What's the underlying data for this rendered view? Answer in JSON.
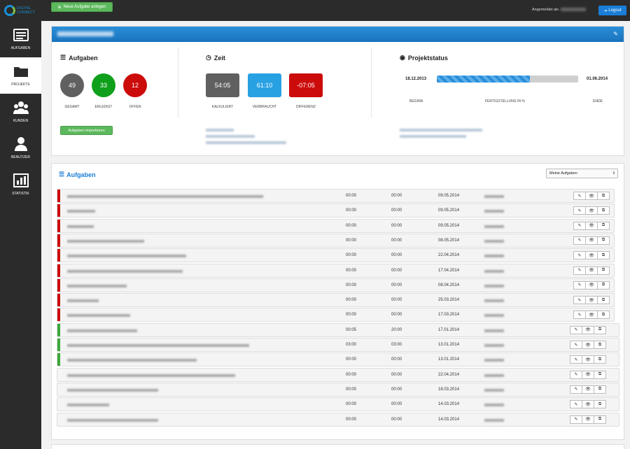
{
  "topbar": {
    "new_task_label": "Neue Aufgabe anlegen",
    "login_label": "Angemeldet als",
    "logout_label": "Logout"
  },
  "sidebar": [
    {
      "label": "AUFGABEN",
      "icon": "tasks-icon"
    },
    {
      "label": "PROJEKTE",
      "icon": "folder-icon",
      "active": true
    },
    {
      "label": "KUNDEN",
      "icon": "users-icon"
    },
    {
      "label": "BENUTZER",
      "icon": "user-icon"
    },
    {
      "label": "STATISTIK",
      "icon": "chart-icon"
    }
  ],
  "overview": {
    "tasks_title": "Aufgaben",
    "tasks": [
      {
        "value": "49",
        "label": "GESAMT",
        "color": "#606060"
      },
      {
        "value": "33",
        "label": "ERLEDIGT",
        "color": "#0fa01b"
      },
      {
        "value": "12",
        "label": "OFFEN",
        "color": "#cc0b0b"
      }
    ],
    "time_title": "Zeit",
    "times": [
      {
        "value": "54:05",
        "label": "KALKULIERT",
        "color": "#606060"
      },
      {
        "value": "61:10",
        "label": "VERBRAUCHT",
        "color": "#28a1e3"
      },
      {
        "value": "-07:05",
        "label": "DIFFERENZ",
        "color": "#cc0b0b"
      }
    ],
    "status_title": "Projektstatus",
    "start_date": "18.12.2013",
    "end_date": "01.06.2014",
    "progress": 0.66,
    "begin_label": "BEGINN",
    "completion_label": "FERTIGSTELLUNG IN %",
    "end_label": "ENDE",
    "import_label": "Aufgaben importieren"
  },
  "task_list": {
    "title": "Aufgaben",
    "filter_value": "Meine Aufgaben",
    "rows": [
      {
        "status": "red",
        "t1": "00:00",
        "t2": "00:00",
        "date": "09.05.2014",
        "len": 280
      },
      {
        "status": "red",
        "t1": "00:00",
        "t2": "00:00",
        "date": "09.05.2014",
        "len": 40
      },
      {
        "status": "red",
        "t1": "00:00",
        "t2": "00:00",
        "date": "09.05.2014",
        "len": 38
      },
      {
        "status": "red",
        "t1": "00:00",
        "t2": "00:00",
        "date": "08.05.2014",
        "len": 110
      },
      {
        "status": "red",
        "t1": "00:00",
        "t2": "00:00",
        "date": "22.04.2014",
        "len": 170
      },
      {
        "status": "red",
        "t1": "00:00",
        "t2": "00:00",
        "date": "17.04.2014",
        "len": 165
      },
      {
        "status": "red",
        "t1": "00:00",
        "t2": "00:00",
        "date": "08.04.2014",
        "len": 85
      },
      {
        "status": "red",
        "t1": "00:00",
        "t2": "00:00",
        "date": "25.03.2014",
        "len": 45
      },
      {
        "status": "red",
        "t1": "00:00",
        "t2": "00:00",
        "date": "17.03.2014",
        "len": 90
      },
      {
        "status": "green",
        "t1": "00:05",
        "t2": "20:00",
        "date": "17.01.2014",
        "len": 100
      },
      {
        "status": "green",
        "t1": "03:00",
        "t2": "03:00",
        "date": "13.01.2014",
        "len": 260
      },
      {
        "status": "green",
        "t1": "00:00",
        "t2": "00:00",
        "date": "13.01.2014",
        "len": 185
      },
      {
        "status": "none",
        "t1": "00:00",
        "t2": "00:00",
        "date": "22.04.2014",
        "len": 240
      },
      {
        "status": "none",
        "t1": "00:00",
        "t2": "00:00",
        "date": "18.03.2014",
        "len": 130
      },
      {
        "status": "none",
        "t1": "00:00",
        "t2": "00:00",
        "date": "14.03.2014",
        "len": 60
      },
      {
        "status": "none",
        "t1": "00:00",
        "t2": "00:00",
        "date": "14.03.2014",
        "len": 130
      }
    ]
  },
  "colors": {
    "accent": "#1a7ed6",
    "success": "#5cb85c",
    "danger": "#cc0b0b"
  }
}
